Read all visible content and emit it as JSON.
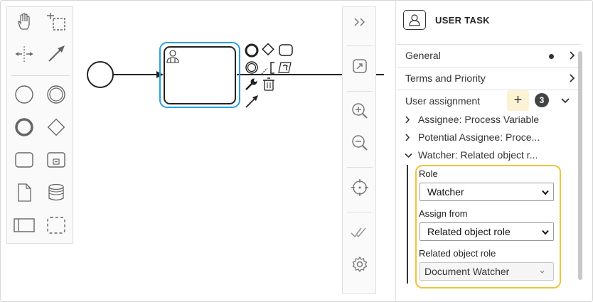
{
  "palette": {
    "tools": [
      {
        "name": "hand-tool-icon"
      },
      {
        "name": "lasso-tool-icon"
      },
      {
        "name": "space-tool-icon"
      },
      {
        "name": "connect-tool-icon"
      },
      {
        "name": "start-event-icon"
      },
      {
        "name": "intermediate-event-icon"
      },
      {
        "name": "end-event-icon"
      },
      {
        "name": "gateway-icon"
      },
      {
        "name": "task-icon"
      },
      {
        "name": "subprocess-icon"
      },
      {
        "name": "data-object-icon"
      },
      {
        "name": "data-store-icon"
      },
      {
        "name": "pool-icon"
      },
      {
        "name": "group-icon"
      }
    ]
  },
  "toolbar": {
    "buttons": [
      {
        "name": "collapse-panel-icon"
      },
      {
        "name": "minimap-icon"
      },
      {
        "name": "zoom-in-icon"
      },
      {
        "name": "zoom-out-icon"
      },
      {
        "name": "center-icon"
      },
      {
        "name": "validate-icon"
      },
      {
        "name": "settings-icon"
      }
    ]
  },
  "panel": {
    "title": "USER TASK",
    "groups": {
      "general": "General",
      "terms": "Terms and Priority",
      "user_assignment": "User assignment",
      "assignment_count": "3",
      "add_symbol": "+"
    },
    "items": [
      {
        "label": "Assignee: Process Variable",
        "expanded": false
      },
      {
        "label": "Potential Assignee: Proce...",
        "expanded": false
      },
      {
        "label": "Watcher: Related object r...",
        "expanded": true
      }
    ],
    "fields": {
      "role_label": "Role",
      "role_value": "Watcher",
      "assign_from_label": "Assign from",
      "assign_from_value": "Related object role",
      "related_role_label": "Related object role",
      "related_role_value": "Document Watcher"
    }
  },
  "colors": {
    "selection": "#2aa0e0",
    "highlight": "#f0c43a",
    "add_button_bg": "#fbf3d4",
    "badge_bg": "#444444"
  }
}
